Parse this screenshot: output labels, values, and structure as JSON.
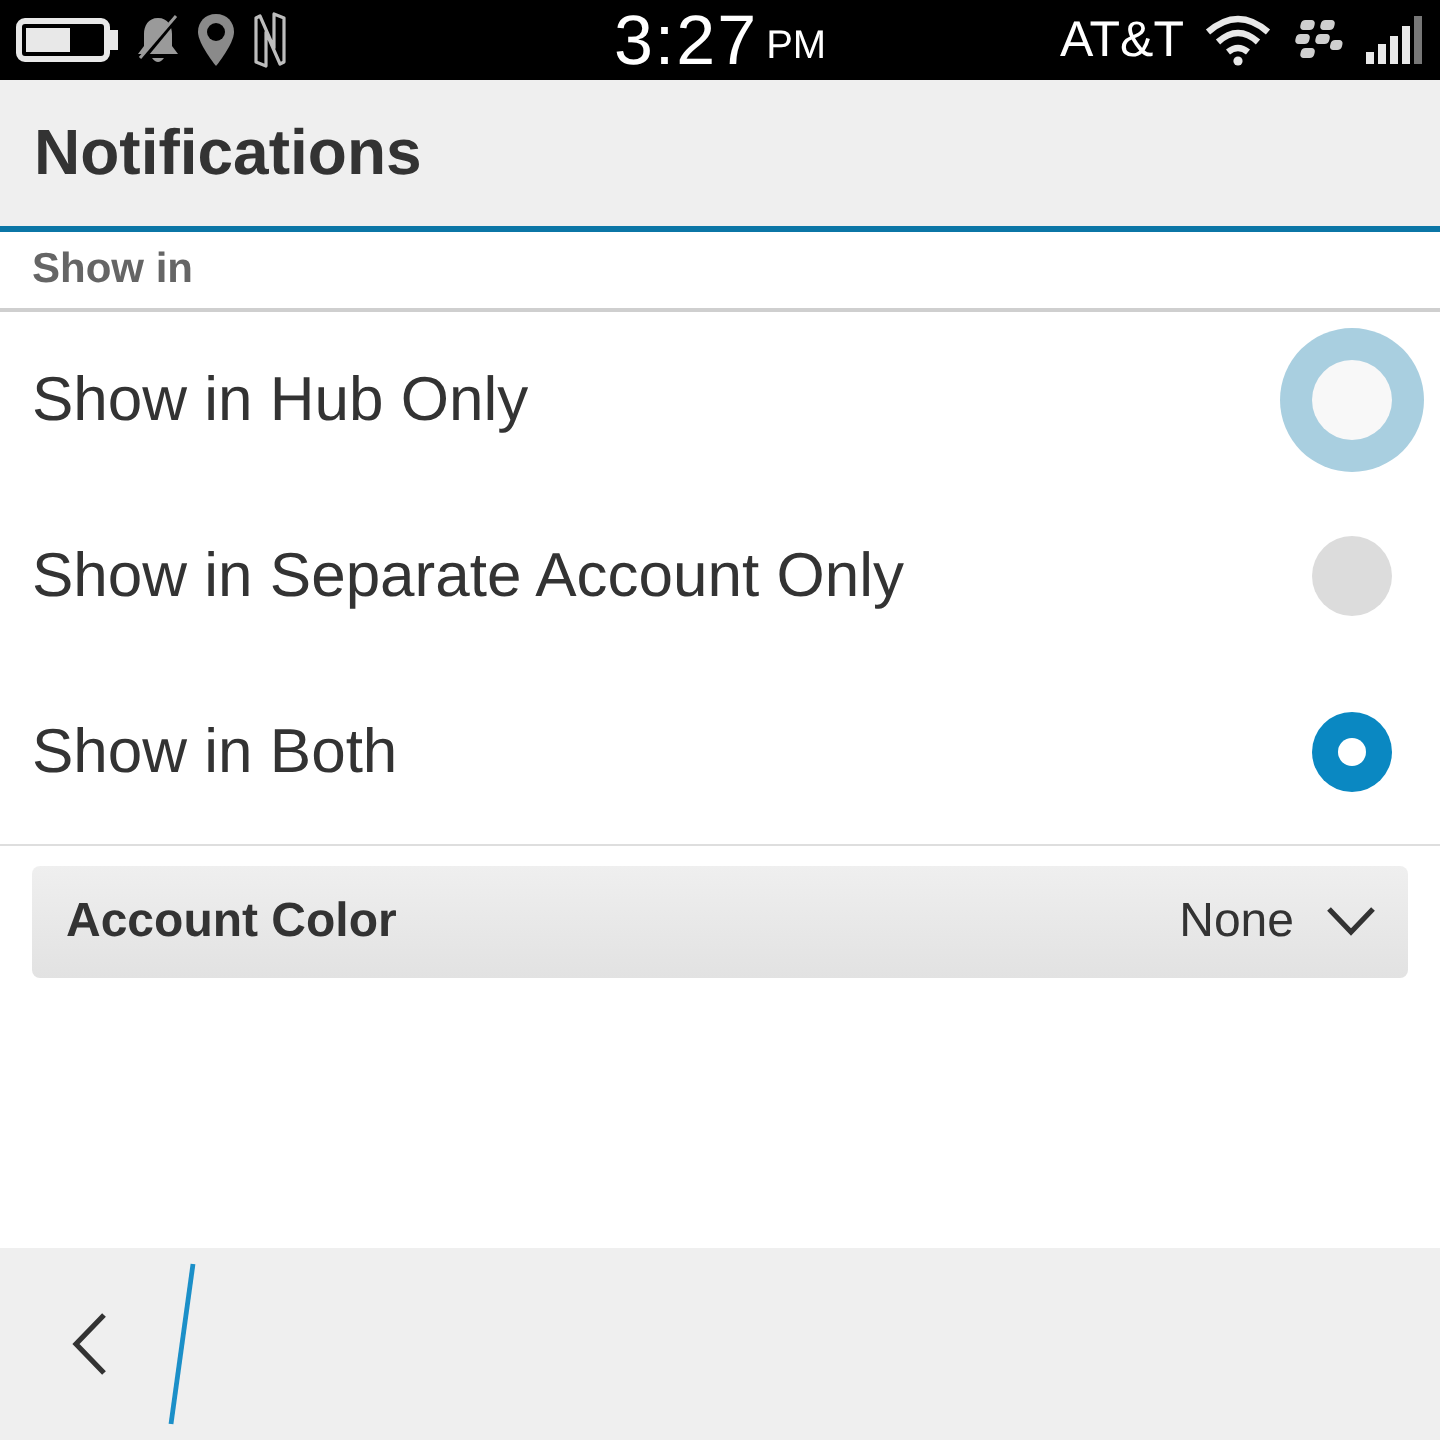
{
  "status_bar": {
    "time": "3:27",
    "am_pm": "PM",
    "carrier": "AT&T"
  },
  "header": {
    "title": "Notifications"
  },
  "section": {
    "title": "Show in"
  },
  "options": [
    {
      "label": "Show in Hub Only",
      "selected": false,
      "focused": true
    },
    {
      "label": "Show in Separate Account Only",
      "selected": false,
      "focused": false
    },
    {
      "label": "Show in Both",
      "selected": true,
      "focused": false
    }
  ],
  "dropdown": {
    "label": "Account Color",
    "value": "None"
  }
}
